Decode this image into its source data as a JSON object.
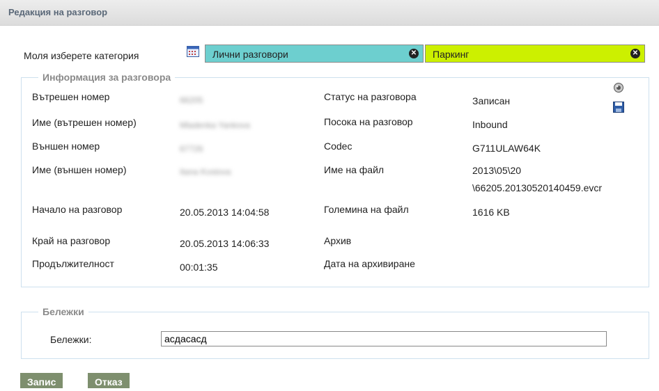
{
  "window": {
    "title": "Редакция на разговор"
  },
  "category": {
    "label": "Моля изберете категория",
    "calendar_icon": "calendar-icon",
    "tags": [
      {
        "text": "Лични разговори",
        "color": "#6dcfcf"
      },
      {
        "text": "Паркинг",
        "color": "#ccf000"
      }
    ]
  },
  "info": {
    "legend": "Информация за разговора",
    "rows_left": [
      {
        "label": "Вътрешен номер",
        "value": "66205"
      },
      {
        "label": "Име (вътрешен номер)",
        "value": "Mladenka Yankova"
      },
      {
        "label": "Външен номер",
        "value": "67726"
      },
      {
        "label": "Име (външен номер)",
        "value": "Itana Kostova"
      },
      {
        "label": "Начало на разговор",
        "value": "20.05.2013 14:04:58"
      },
      {
        "label": "Край на разговор",
        "value": "20.05.2013 14:06:33"
      },
      {
        "label": "Продължителност",
        "value": "00:01:35"
      }
    ],
    "rows_right": [
      {
        "label": "Статус на разговора",
        "value": "Записан"
      },
      {
        "label": "Посока на разговор",
        "value": "Inbound"
      },
      {
        "label": "Codec",
        "value": "G711ULAW64K"
      },
      {
        "label": "Име на файл",
        "value": "2013\\05\\20",
        "value2": "\\66205.20130520140459.evcr"
      },
      {
        "label": "Големина на файл",
        "value": "1616 KB"
      },
      {
        "label": "Архив",
        "value": ""
      },
      {
        "label": "Дата на архивиране",
        "value": ""
      }
    ],
    "icons": [
      "speaker-icon",
      "save-icon"
    ]
  },
  "notes": {
    "legend": "Бележки",
    "label": "Бележки:",
    "value": "асдасасд"
  },
  "buttons": {
    "save": "Запис",
    "cancel": "Отказ"
  }
}
